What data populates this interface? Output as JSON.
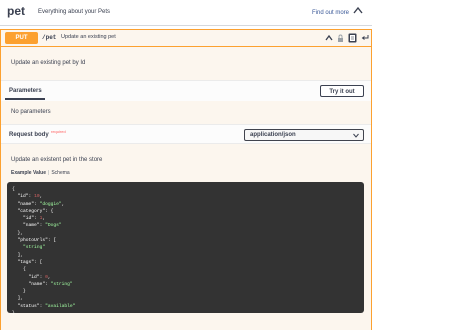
{
  "tag": {
    "name": "pet",
    "description": "Everything about your Pets",
    "find_out_more": "Find out more"
  },
  "operation": {
    "method": "PUT",
    "path": "/pet",
    "summary": "Update an existing pet",
    "description": "Update an existing pet by Id"
  },
  "parameters": {
    "title": "Parameters",
    "try_button": "Try it out",
    "empty_text": "No parameters"
  },
  "request_body": {
    "title": "Request body",
    "required": "required",
    "content_type": "application/json",
    "description": "Update an existent pet in the store",
    "tab_example": "Example Value",
    "tab_schema": "Schema"
  },
  "example_json": {
    "id": 10,
    "name": "doggie",
    "category": {
      "id": 1,
      "name": "Dogs"
    },
    "photoUrls": [
      "string"
    ],
    "tags": [
      {
        "id": 0,
        "name": "string"
      }
    ],
    "status": "available"
  },
  "colors": {
    "put": "#fca130",
    "put_bg": "#fcf6ee",
    "code_bg": "#333333",
    "code_string": "#a2fca2",
    "code_number": "#d36363"
  },
  "icons": [
    "chevron-up-icon",
    "lock-icon",
    "copy-icon",
    "return-icon"
  ]
}
